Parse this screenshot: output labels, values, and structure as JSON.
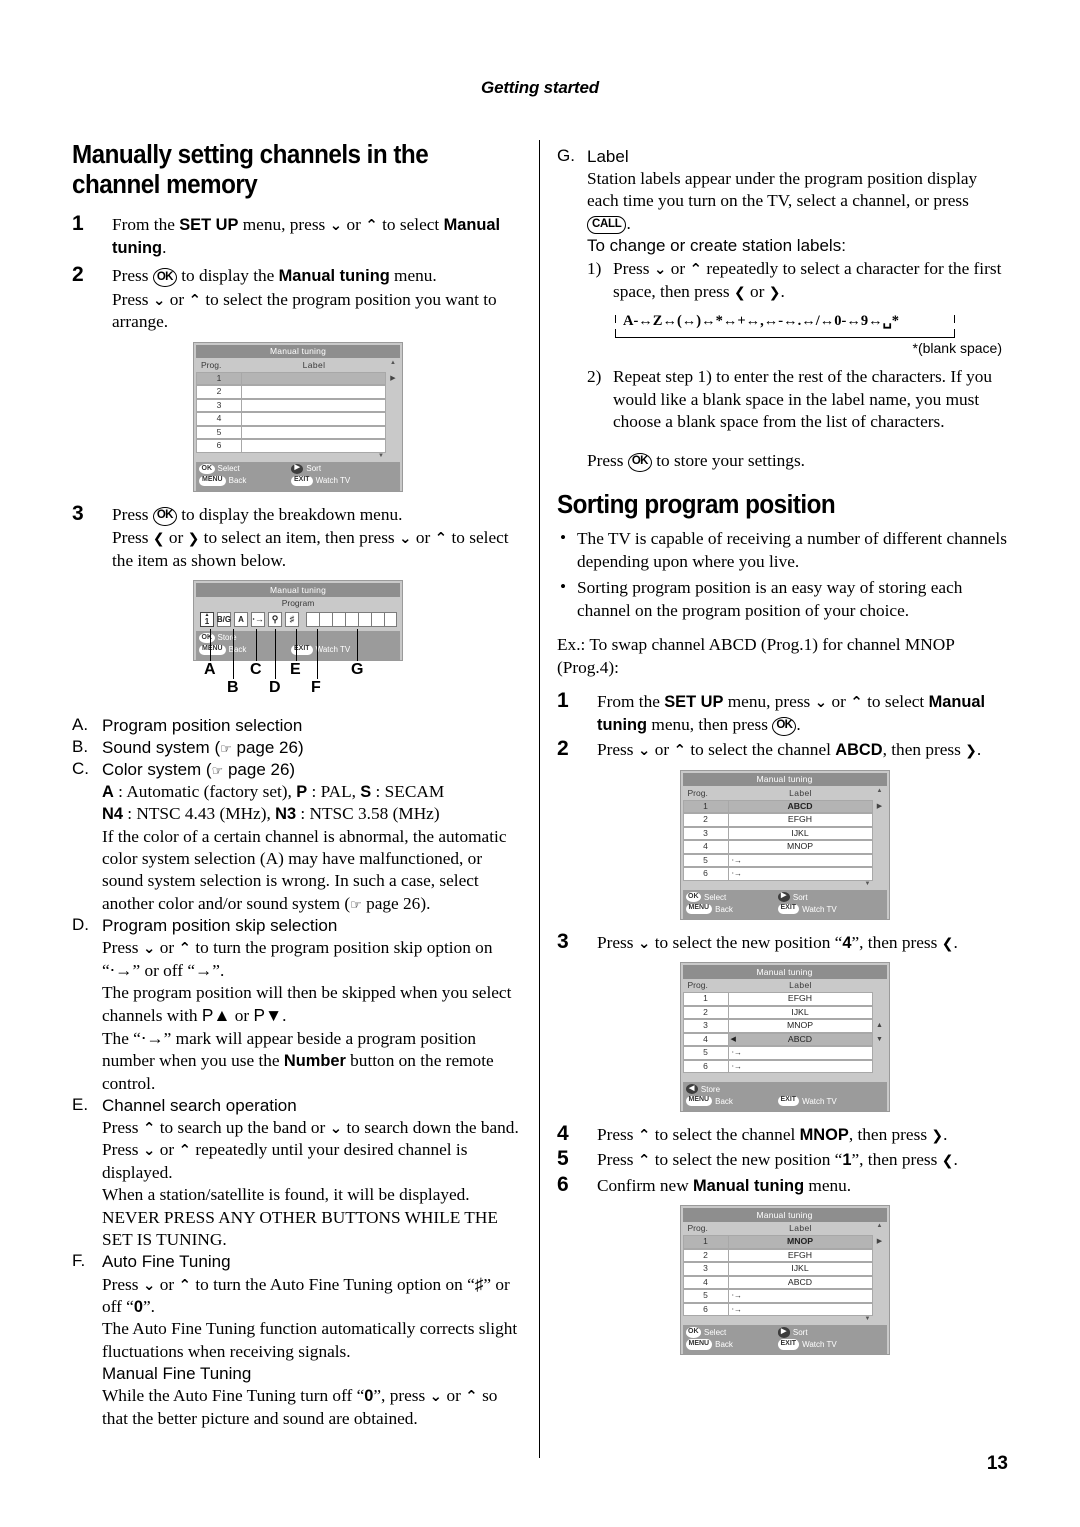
{
  "header": {
    "running_head": "Getting started"
  },
  "page_number": "13",
  "left": {
    "heading": "Manually setting channels in the channel memory",
    "steps": [
      {
        "num": "1",
        "lines": [
          "From the SET UP menu, press ⌄ or ⌃ to select Manual tuning."
        ]
      },
      {
        "num": "2",
        "lines": [
          "Press OK to display the Manual tuning menu.",
          "Press ⌄ or ⌃ to select the program position you want to arrange."
        ]
      },
      {
        "num": "3",
        "lines": [
          "Press OK to display the breakdown menu.",
          "Press ❮ or ❯ to select an item, then press ⌄ or ⌃ to select the item as shown below."
        ]
      }
    ],
    "osd1": {
      "title": "Manual tuning",
      "col_prog": "Prog.",
      "col_label": "Label",
      "rows": [
        {
          "prog": "1",
          "label": "",
          "selected": true
        },
        {
          "prog": "2",
          "label": "",
          "selected": false
        },
        {
          "prog": "3",
          "label": "",
          "selected": false
        },
        {
          "prog": "4",
          "label": "",
          "selected": false
        },
        {
          "prog": "5",
          "label": "",
          "selected": false
        },
        {
          "prog": "6",
          "label": "",
          "selected": false
        }
      ],
      "footer": [
        {
          "key": "OK",
          "text": "Select"
        },
        {
          "key": "▶",
          "text": "Sort"
        },
        {
          "key": "MENU",
          "text": "Back"
        },
        {
          "key": "EXIT",
          "text": "Watch TV"
        }
      ]
    },
    "osd_breakdown": {
      "title": "Manual tuning",
      "subtitle": "Program",
      "cells": [
        "1",
        "B/G",
        "A",
        "⊷",
        "🔍",
        "⌗"
      ],
      "footer": [
        {
          "key": "OK",
          "text": "Store"
        },
        {
          "key": "MENU",
          "text": "Back"
        },
        {
          "key": "EXIT",
          "text": "Watch TV"
        }
      ],
      "callout_letters": [
        "A",
        "B",
        "C",
        "D",
        "E",
        "F",
        "G"
      ]
    },
    "lettered_items": [
      {
        "mark": "A.",
        "title": "Program position selection",
        "body": []
      },
      {
        "mark": "B.",
        "title": "Sound system (☞ page 26)",
        "body": []
      },
      {
        "mark": "C.",
        "title": "Color system (☞ page 26)",
        "body": [
          "A : Automatic (factory set), P : PAL, S : SECAM",
          "N4 : NTSC 4.43 (MHz), N3 : NTSC 3.58 (MHz)",
          "If the color of a certain channel is abnormal, the automatic color system selection (A) may have malfunctioned, or sound system selection is wrong. In such a case, select another color and/or sound system (☞ page 26)."
        ]
      },
      {
        "mark": "D.",
        "title": "Program position skip selection",
        "body": [
          "Press ⌄ or ⌃ to turn the program position skip option on “⊷” or off “⊶”.",
          "The program position will then be skipped when you select channels with P▲ or P▼.",
          "The “⊷” mark will appear beside a program position number when you use the Number button on the remote control."
        ]
      },
      {
        "mark": "E.",
        "title": "Channel search operation",
        "body": [
          "Press ⌃ to search up the band or ⌄ to search down the band.",
          "Press ⌄ or ⌃ repeatedly until your desired channel is displayed.",
          "When a station/satellite is found, it will be displayed. NEVER PRESS ANY OTHER BUTTONS WHILE THE SET IS TUNING."
        ]
      },
      {
        "mark": "F.",
        "title": "Auto Fine Tuning",
        "body": [
          "Press ⌄ or ⌃ to turn the Auto Fine Tuning option on “⌗” or off “0”.",
          "The Auto Fine Tuning function automatically corrects slight fluctuations when receiving signals."
        ],
        "subheading": "Manual Fine Tuning",
        "subbody": [
          "While the Auto Fine Tuning turn off “0”, press ⌄ or ⌃ so that the better picture and sound are obtained."
        ]
      }
    ]
  },
  "right": {
    "label_item": {
      "mark": "G.",
      "title": "Label",
      "body": "Station labels appear under the program position display each time you turn on the TV, select a channel, or press CALL.",
      "call_key": "CALL",
      "subheading": "To change or create station labels:",
      "steps": [
        "1) Press ⌄ or ⌃ repeatedly to select a character for the first space, then press ❮ or ❯.",
        "2) Repeat step 1) to enter the rest of the characters. If you would like a blank space in the label name, you must choose a blank space from the list of characters."
      ],
      "char_sequence": "A-↔Z↔(↔)↔*↔+↔,↔-↔.↔/↔0-↔9↔␣*",
      "blank_space_note": "*(blank space)",
      "store_line": "Press OK to store your settings."
    },
    "sorting": {
      "heading": "Sorting program position",
      "bullets": [
        "The TV is capable of receiving a number of different channels depending upon where you live.",
        "Sorting program position is an easy way of storing each channel on the program position of your choice."
      ],
      "example": "Ex.: To swap channel ABCD (Prog.1) for channel MNOP (Prog.4):",
      "steps": [
        {
          "num": "1",
          "text": "From the SET UP menu, press ⌄ or ⌃ to select Manual tuning menu, then press OK."
        },
        {
          "num": "2",
          "text": "Press ⌄ or ⌃ to select the channel ABCD, then press ❯."
        },
        {
          "num": "3",
          "text": "Press ⌄ to select the new position “4”, then press ❮."
        },
        {
          "num": "4",
          "text": "Press ⌃ to select the channel MNOP, then press ❯."
        },
        {
          "num": "5",
          "text": "Press ⌃ to select the new position “1”, then press ❮."
        },
        {
          "num": "6",
          "text": "Confirm new Manual tuning menu."
        }
      ],
      "osd2": {
        "title": "Manual tuning",
        "col_prog": "Prog.",
        "col_label": "Label",
        "rows": [
          {
            "prog": "1",
            "label": "ABCD",
            "selected": true,
            "skip": false
          },
          {
            "prog": "2",
            "label": "EFGH",
            "selected": false,
            "skip": false
          },
          {
            "prog": "3",
            "label": "IJKL",
            "selected": false,
            "skip": false
          },
          {
            "prog": "4",
            "label": "MNOP",
            "selected": false,
            "skip": false
          },
          {
            "prog": "5",
            "label": "",
            "selected": false,
            "skip": true
          },
          {
            "prog": "6",
            "label": "",
            "selected": false,
            "skip": true
          }
        ],
        "footer": [
          {
            "key": "OK",
            "text": "Select"
          },
          {
            "key": "▶",
            "text": "Sort"
          },
          {
            "key": "MENU",
            "text": "Back"
          },
          {
            "key": "EXIT",
            "text": "Watch TV"
          }
        ]
      },
      "osd3": {
        "title": "Manual tuning",
        "col_prog": "Prog.",
        "col_label": "Label",
        "rows": [
          {
            "prog": "1",
            "label": "EFGH",
            "selected": false,
            "skip": false
          },
          {
            "prog": "2",
            "label": "IJKL",
            "selected": false,
            "skip": false
          },
          {
            "prog": "3",
            "label": "MNOP",
            "selected": false,
            "skip": false
          },
          {
            "prog": "4",
            "label": "ABCD",
            "selected": true,
            "skip": false
          },
          {
            "prog": "5",
            "label": "",
            "selected": false,
            "skip": true
          },
          {
            "prog": "6",
            "label": "",
            "selected": false,
            "skip": true
          }
        ],
        "footer": [
          {
            "key": "◀",
            "text": "Store"
          },
          {
            "key": "MENU",
            "text": "Back"
          },
          {
            "key": "EXIT",
            "text": "Watch TV"
          }
        ]
      },
      "osd4": {
        "title": "Manual tuning",
        "col_prog": "Prog.",
        "col_label": "Label",
        "rows": [
          {
            "prog": "1",
            "label": "MNOP",
            "selected": true,
            "skip": false
          },
          {
            "prog": "2",
            "label": "EFGH",
            "selected": false,
            "skip": false
          },
          {
            "prog": "3",
            "label": "IJKL",
            "selected": false,
            "skip": false
          },
          {
            "prog": "4",
            "label": "ABCD",
            "selected": false,
            "skip": false
          },
          {
            "prog": "5",
            "label": "",
            "selected": false,
            "skip": true
          },
          {
            "prog": "6",
            "label": "",
            "selected": false,
            "skip": true
          }
        ],
        "footer": [
          {
            "key": "OK",
            "text": "Select"
          },
          {
            "key": "▶",
            "text": "Sort"
          },
          {
            "key": "MENU",
            "text": "Back"
          },
          {
            "key": "EXIT",
            "text": "Watch TV"
          }
        ]
      }
    }
  }
}
